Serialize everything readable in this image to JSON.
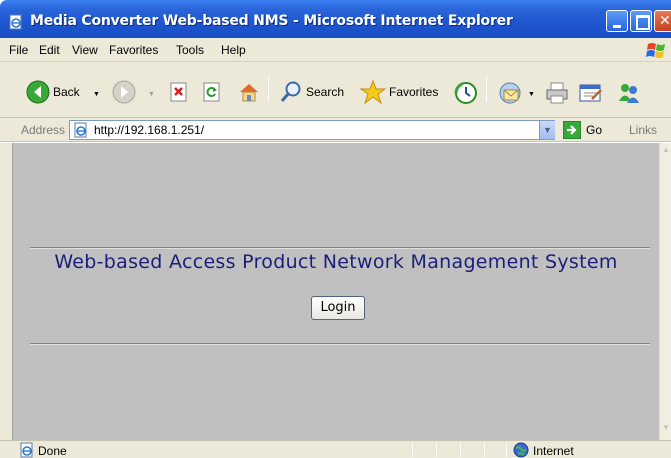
{
  "window": {
    "title": "Media Converter Web-based NMS - Microsoft Internet Explorer"
  },
  "menu": {
    "items": [
      "File",
      "Edit",
      "View",
      "Favorites",
      "Tools",
      "Help"
    ]
  },
  "toolbar": {
    "back_label": "Back",
    "search_label": "Search",
    "favorites_label": "Favorites"
  },
  "address": {
    "label": "Address",
    "url": "http://192.168.1.251/",
    "go_label": "Go",
    "links_label": "Links"
  },
  "page": {
    "heading": "Web-based Access Product Network Management System",
    "login_label": "Login"
  },
  "status": {
    "text": "Done",
    "zone": "Internet"
  },
  "colors": {
    "titlebar": "#1e56cf",
    "content_bg": "#c0c0c0",
    "heading_text": "#1a1f7a",
    "chrome": "#ece9d8"
  }
}
